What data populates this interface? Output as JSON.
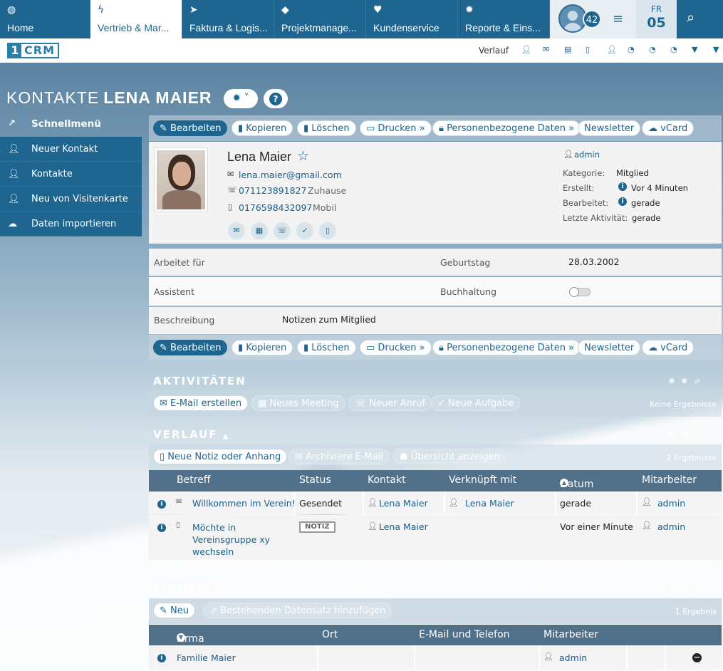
{
  "nav": {
    "tabs": [
      {
        "icon": "globe-icon",
        "glyph": "◍",
        "label": "Home"
      },
      {
        "icon": "bolt-icon",
        "glyph": "ϟ",
        "label": "Vertrieb & Mar..."
      },
      {
        "icon": "paper-plane-icon",
        "glyph": "➤",
        "label": "Faktura & Logis..."
      },
      {
        "icon": "cube-icon",
        "glyph": "◆",
        "label": "Projektmanage..."
      },
      {
        "icon": "heart-icon",
        "glyph": "♥",
        "label": "Kundenservice"
      },
      {
        "icon": "gear-icon",
        "glyph": "✹",
        "label": "Reporte & Eins..."
      }
    ],
    "notification_count": "42",
    "day_name": "FR",
    "day_number": "05"
  },
  "subbar": {
    "logo_num": "1",
    "logo_text": "CRM",
    "history_label": "Verlauf"
  },
  "page": {
    "module": "KONTAKTE",
    "record": "LENA MAIER"
  },
  "sidebar": {
    "header": "Schnellmenü",
    "items": [
      {
        "label": "Neuer Kontakt",
        "icon": "user-icon"
      },
      {
        "label": "Kontakte",
        "icon": "user-icon"
      },
      {
        "label": "Neu von Visitenkarte",
        "icon": "user-icon"
      },
      {
        "label": "Daten importieren",
        "icon": "cloud-upload-icon"
      }
    ]
  },
  "toolbar": {
    "edit": "Bearbeiten",
    "copy": "Kopieren",
    "delete": "Löschen",
    "print": "Drucken",
    "personal": "Personenbezogene Daten",
    "newsletter": "Newsletter",
    "vcard": "vCard"
  },
  "contact": {
    "name": "Lena Maier",
    "email": "lena.maier@gmail.com",
    "phone_home": "071123891827",
    "phone_home_type": "Zuhause",
    "phone_mobile": "0176598432097",
    "phone_mobile_type": "Mobil",
    "assigned_user": "admin",
    "category_label": "Kategorie:",
    "category": "Mitglied",
    "created_label": "Erstellt:",
    "created": "Vor 4 Minuten",
    "modified_label": "Bearbeitet:",
    "modified": "gerade",
    "last_activity_label": "Letzte Aktivität:",
    "last_activity": "gerade"
  },
  "details": {
    "works_for_label": "Arbeitet für",
    "works_for": "",
    "birthday_label": "Geburtstag",
    "birthday": "28.03.2002",
    "assistant_label": "Assistent",
    "assistant": "",
    "accounting_label": "Buchhaltung",
    "description_label": "Beschreibung",
    "description": "Notizen zum Mitglied"
  },
  "activities": {
    "title": "AKTIVITÄTEN",
    "btn_email": "E-Mail erstellen",
    "btn_meeting": "Neues Meeting",
    "btn_call": "Neuer Anruf",
    "btn_task": "Neue Aufgabe",
    "result": "Keine Ergebnisse"
  },
  "history": {
    "title": "VERLAUF",
    "btn_note": "Neue Notiz oder Anhang",
    "btn_archive": "Archiviere E-Mail",
    "btn_overview": "Übersicht anzeigen",
    "result": "2 Ergebnisse",
    "columns": [
      "Betreff",
      "Status",
      "Kontakt",
      "Verknüpft mit",
      "Datum",
      "Mitarbeiter"
    ],
    "rows": [
      {
        "subject": "Willkommen im Verein!",
        "status": "Gesendet",
        "contact": "Lena Maier",
        "linked": "Lena Maier",
        "date": "gerade",
        "user": "admin"
      },
      {
        "subject": "Möchte in Vereinsgruppe xy wechseln",
        "status": "NOTIZ",
        "contact": "Lena Maier",
        "linked": "",
        "date": "Vor einer Minute",
        "user": "admin"
      }
    ]
  },
  "companies": {
    "title": "FIRMEN",
    "btn_new": "Neu",
    "btn_existing": "Bestehenden Datensatz hinzufügen",
    "result": "1 Ergebnis",
    "columns": [
      "Firma",
      "Ort",
      "E-Mail und Telefon",
      "Mitarbeiter"
    ],
    "rows": [
      {
        "company": "Familie Maier",
        "city": "",
        "contact": "",
        "user": "admin"
      }
    ]
  }
}
